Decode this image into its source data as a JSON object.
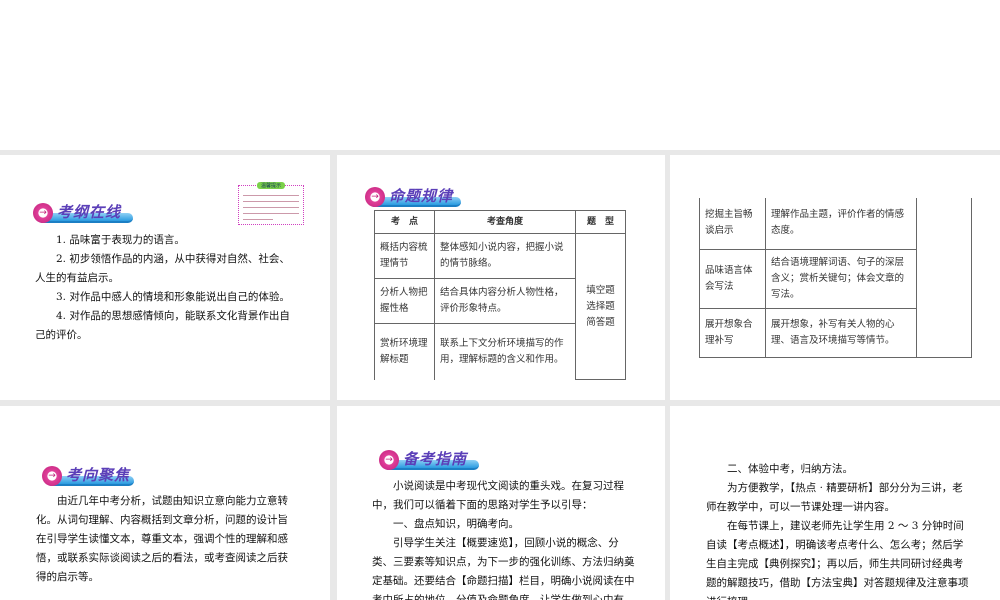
{
  "slides": [
    {
      "title": "考纲在线",
      "note_title": "温馨提示",
      "items": [
        "1. 品味富于表现力的语言。",
        "2. 初步领悟作品的内涵，从中获得对自然、社会、人生的有益启示。",
        "3. 对作品中感人的情境和形象能说出自己的体验。",
        "4. 对作品的思想感情倾向，能联系文化背景作出自己的评价。"
      ]
    },
    {
      "title": "命题规律",
      "headers": [
        "考　点",
        "考查角度",
        "题　型"
      ],
      "rows": [
        [
          "概括内容梳理情节",
          "整体感知小说内容，把握小说的情节脉络。"
        ],
        [
          "分析人物把握性格",
          "结合具体内容分析人物性格，评价形象特点。"
        ],
        [
          "赏析环境理解标题",
          "联系上下文分析环境描写的作用，理解标题的含义和作用。"
        ]
      ],
      "types": "填空题 选择题 简答题"
    },
    {
      "rows": [
        [
          "挖掘主旨畅谈启示",
          "理解作品主题，评价作者的情感态度。"
        ],
        [
          "品味语言体会写法",
          "结合语境理解词语、句子的深层含义；赏析关键句；体会文章的写法。"
        ],
        [
          "展开想象合理补写",
          "展开想象，补写有关人物的心理、语言及环境描写等情节。"
        ]
      ]
    },
    {
      "title": "考向聚焦",
      "para": "由近几年中考分析，试题由知识立意向能力立意转化。从词句理解、内容概括到文章分析，问题的设计旨在引导学生读懂文本，尊重文本，强调个性的理解和感悟，或联系实际谈阅读之后的看法，或考查阅读之后获得的启示等。"
    },
    {
      "title": "备考指南",
      "paras": [
        "小说阅读是中考现代文阅读的重头戏。在复习过程中，我们可以循着下面的思路对学生予以引导：",
        "一、盘点知识，明确考向。",
        "引导学生关注【概要速览】，回顾小说的概念、分类、三要素等知识点，为下一步的强化训练、方法归纳奠定基础。还要结合【命题扫描】栏目，明确小说阅读在中考中所占的地位、分值及命题角度，让学生做到心中有数。"
      ]
    },
    {
      "paras": [
        "二、体验中考，归纳方法。",
        "为方便教学，【热点 · 精要研析】部分分为三讲，老师在教学中，可以一节课处理一讲内容。",
        "在每节课上，建议老师先让学生用 2 ～ 3 分钟时间自读【考点概述】，明确该考点考什么、怎么考；然后学生自主完成【典例探究】；再以后，师生共同研讨经典考题的解题技巧，借助【方法宝典】对答题规律及注意事项进行梳理。"
      ]
    }
  ]
}
